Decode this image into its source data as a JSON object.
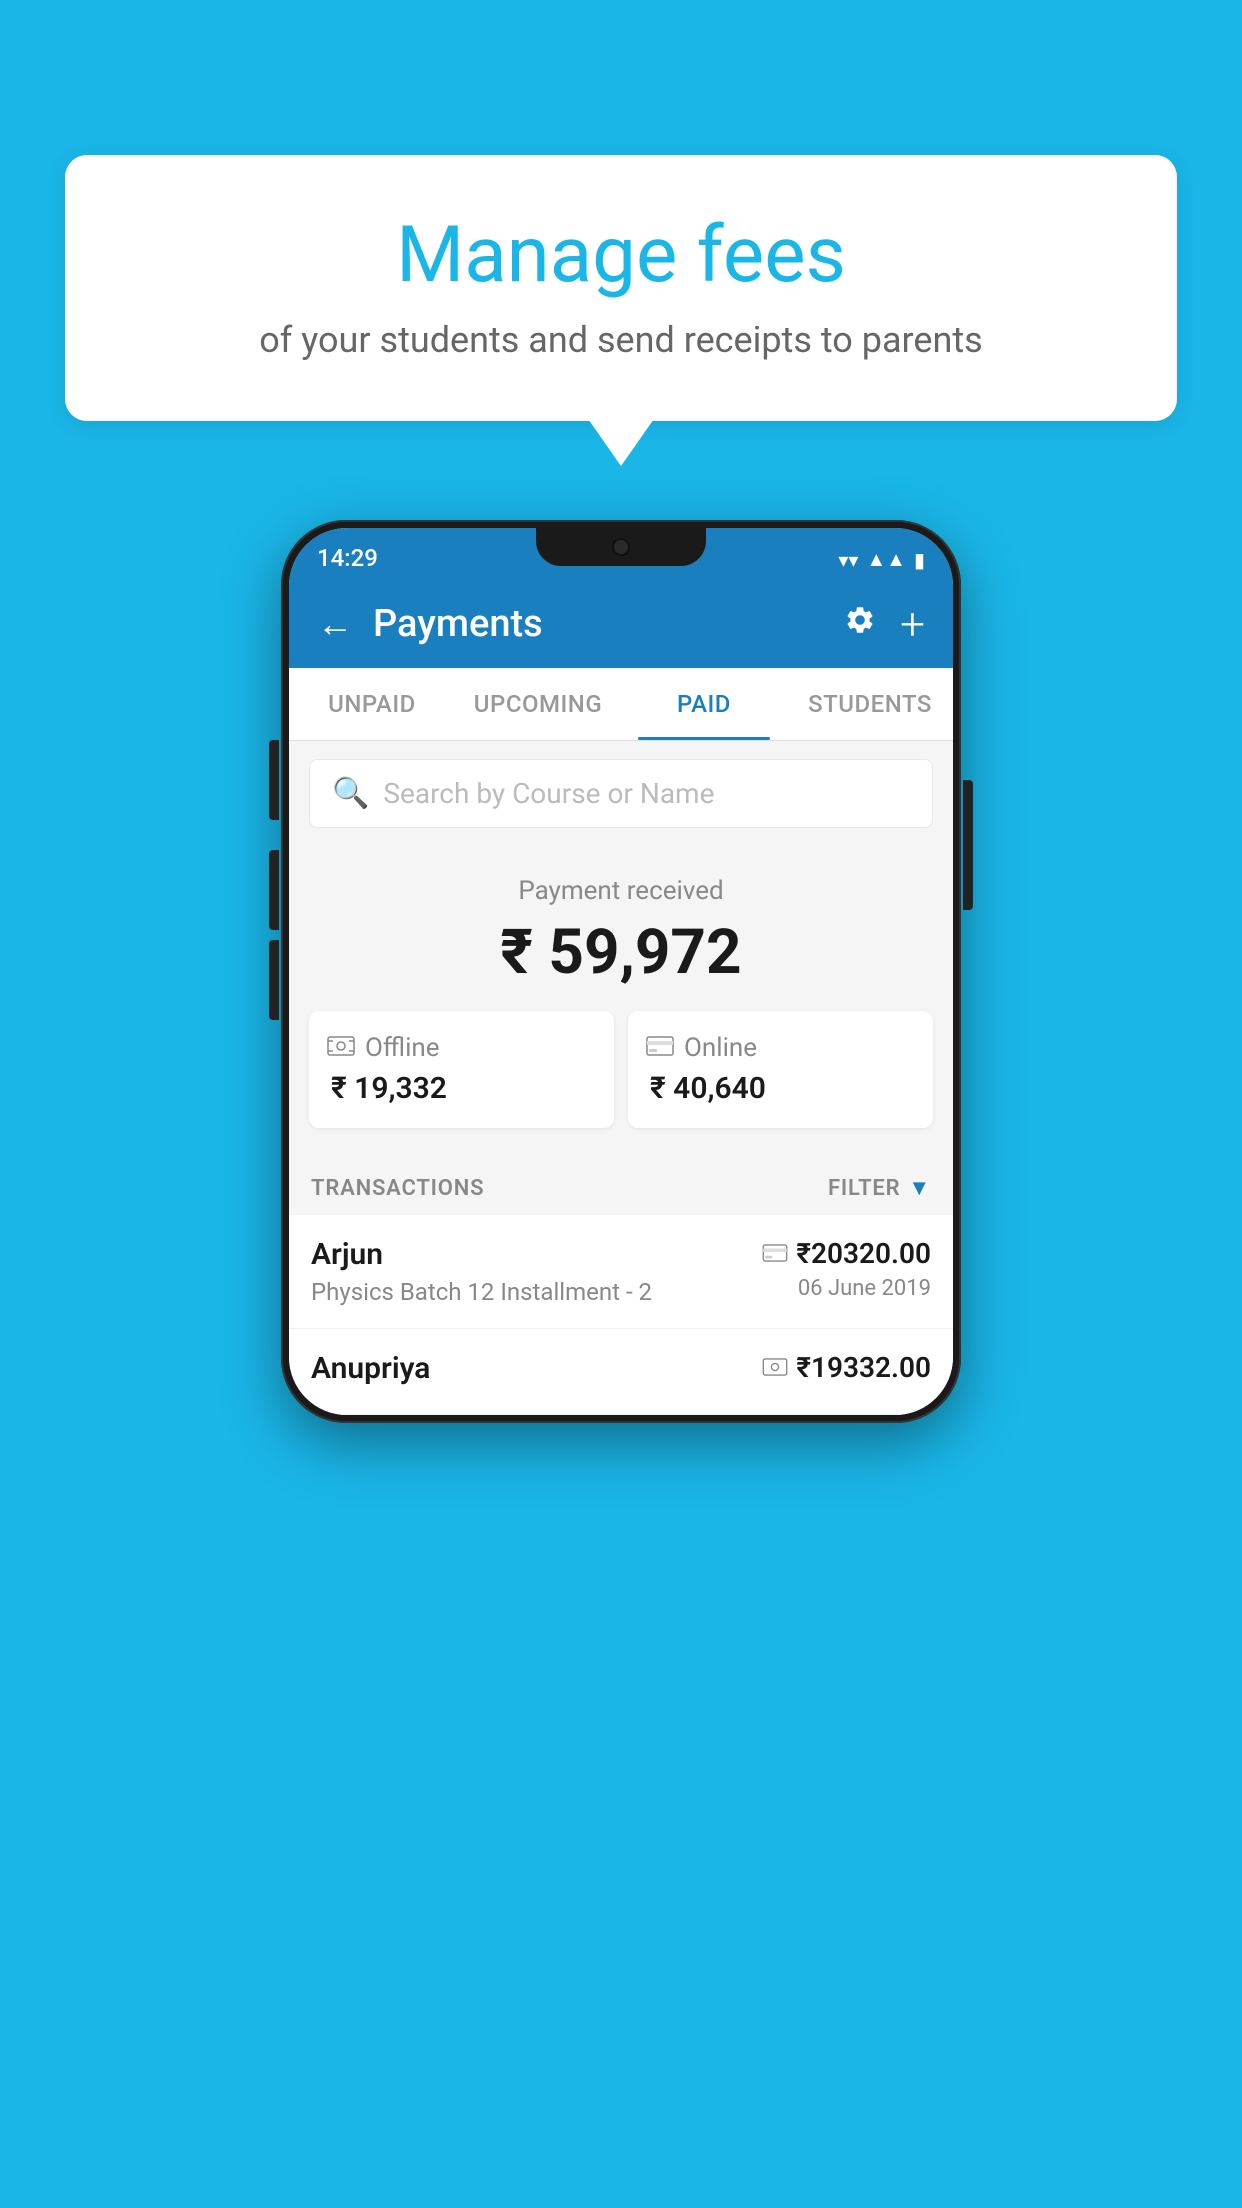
{
  "background_color": "#1ab6e8",
  "speech_bubble": {
    "title": "Manage fees",
    "subtitle": "of your students and send receipts to parents"
  },
  "status_bar": {
    "time": "14:29",
    "icons": [
      "wifi",
      "signal",
      "battery"
    ]
  },
  "header": {
    "title": "Payments",
    "back_label": "←",
    "settings_label": "⚙",
    "add_label": "+"
  },
  "tabs": [
    {
      "label": "UNPAID",
      "active": false
    },
    {
      "label": "UPCOMING",
      "active": false
    },
    {
      "label": "PAID",
      "active": true
    },
    {
      "label": "STUDENTS",
      "active": false
    }
  ],
  "search": {
    "placeholder": "Search by Course or Name"
  },
  "payment_summary": {
    "label": "Payment received",
    "total": "₹ 59,972",
    "offline": {
      "label": "Offline",
      "amount": "₹ 19,332"
    },
    "online": {
      "label": "Online",
      "amount": "₹ 40,640"
    }
  },
  "transactions_section": {
    "label": "TRANSACTIONS",
    "filter_label": "FILTER"
  },
  "transactions": [
    {
      "name": "Arjun",
      "course": "Physics Batch 12 Installment - 2",
      "amount": "₹20320.00",
      "date": "06 June 2019",
      "method": "card"
    },
    {
      "name": "Anupriya",
      "course": "",
      "amount": "₹19332.00",
      "date": "",
      "method": "cash"
    }
  ]
}
